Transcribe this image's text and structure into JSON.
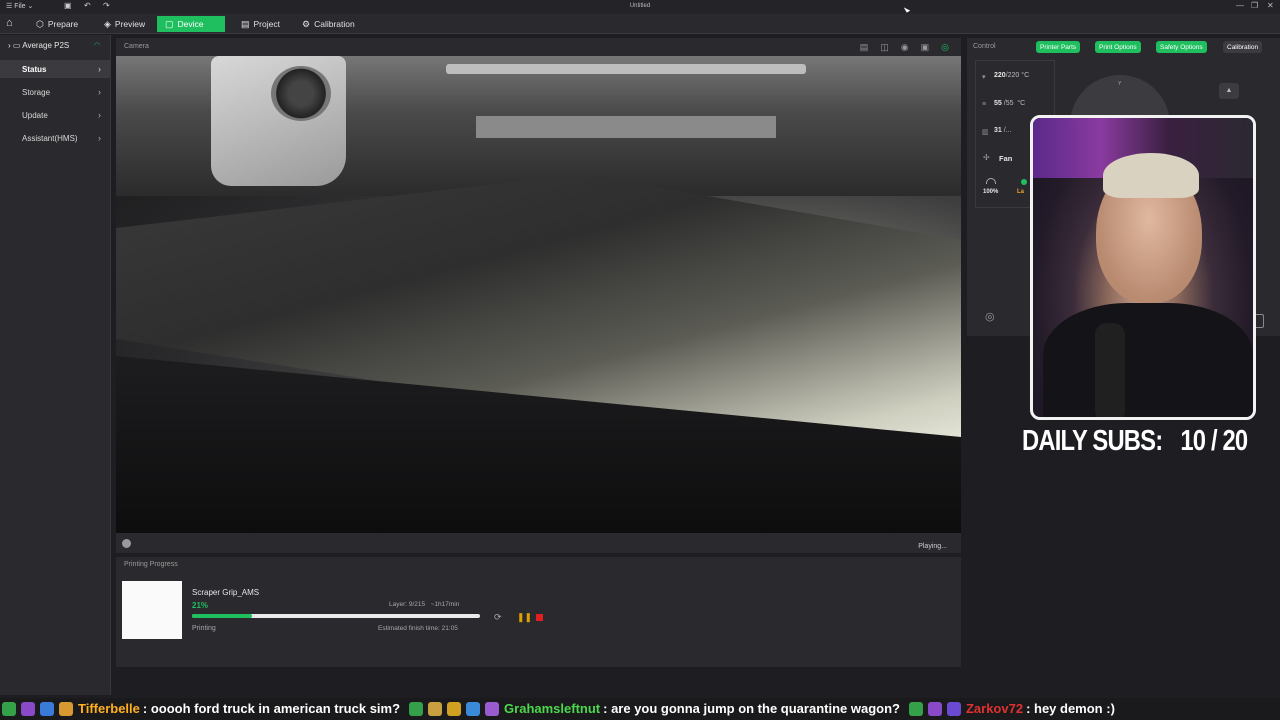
{
  "titlebar": {
    "menu_label": "File",
    "title": "Untitled"
  },
  "tabs": [
    {
      "label": "Prepare"
    },
    {
      "label": "Preview"
    },
    {
      "label": "Device"
    },
    {
      "label": "Project"
    },
    {
      "label": "Calibration"
    }
  ],
  "sidebar": {
    "device_name": "Average P2S",
    "items": [
      {
        "label": "Status"
      },
      {
        "label": "Storage"
      },
      {
        "label": "Update"
      },
      {
        "label": "Assistant(HMS)"
      }
    ]
  },
  "camera": {
    "header": "Camera",
    "status": "Playing..."
  },
  "progress": {
    "header": "Printing Progress",
    "job_name": "Scraper Grip_AMS",
    "percent_label": "21%",
    "percent": 21,
    "layer": "Layer: 9/215",
    "remaining": "~1h17min",
    "status": "Printing",
    "finish": "Estimated finish time: 21:05"
  },
  "control": {
    "header": "Control",
    "buttons": [
      "Printer Parts",
      "Print Options",
      "Safety Options",
      "Calibration"
    ],
    "nozzle": {
      "current": "220",
      "target": "/220",
      "unit": "°C"
    },
    "bed": {
      "current": "55",
      "target": "/55",
      "unit": "°C"
    },
    "chamber": {
      "current": "31",
      "target": "/..."
    },
    "fan_label": "Fan",
    "fan_pct": "100%",
    "fan_part_label": "La",
    "jog_label": "Y"
  },
  "overlay": {
    "subs_label": "DAILY SUBS:",
    "subs_count": "10 / 20"
  },
  "chat": [
    {
      "user": "Tifferbelle",
      "user_color": "#ffb020",
      "message": ": ooooh ford truck in american truck sim?"
    },
    {
      "user": "Grahamsleftnut",
      "user_color": "#4cd84c",
      "message": ": are you gonna jump on the quarantine wagon?"
    },
    {
      "user": "Zarkov72",
      "user_color": "#e03030",
      "message": ": hey demon :)"
    }
  ],
  "colors": {
    "accent": "#1fbf5f",
    "stop": "#e02020"
  }
}
